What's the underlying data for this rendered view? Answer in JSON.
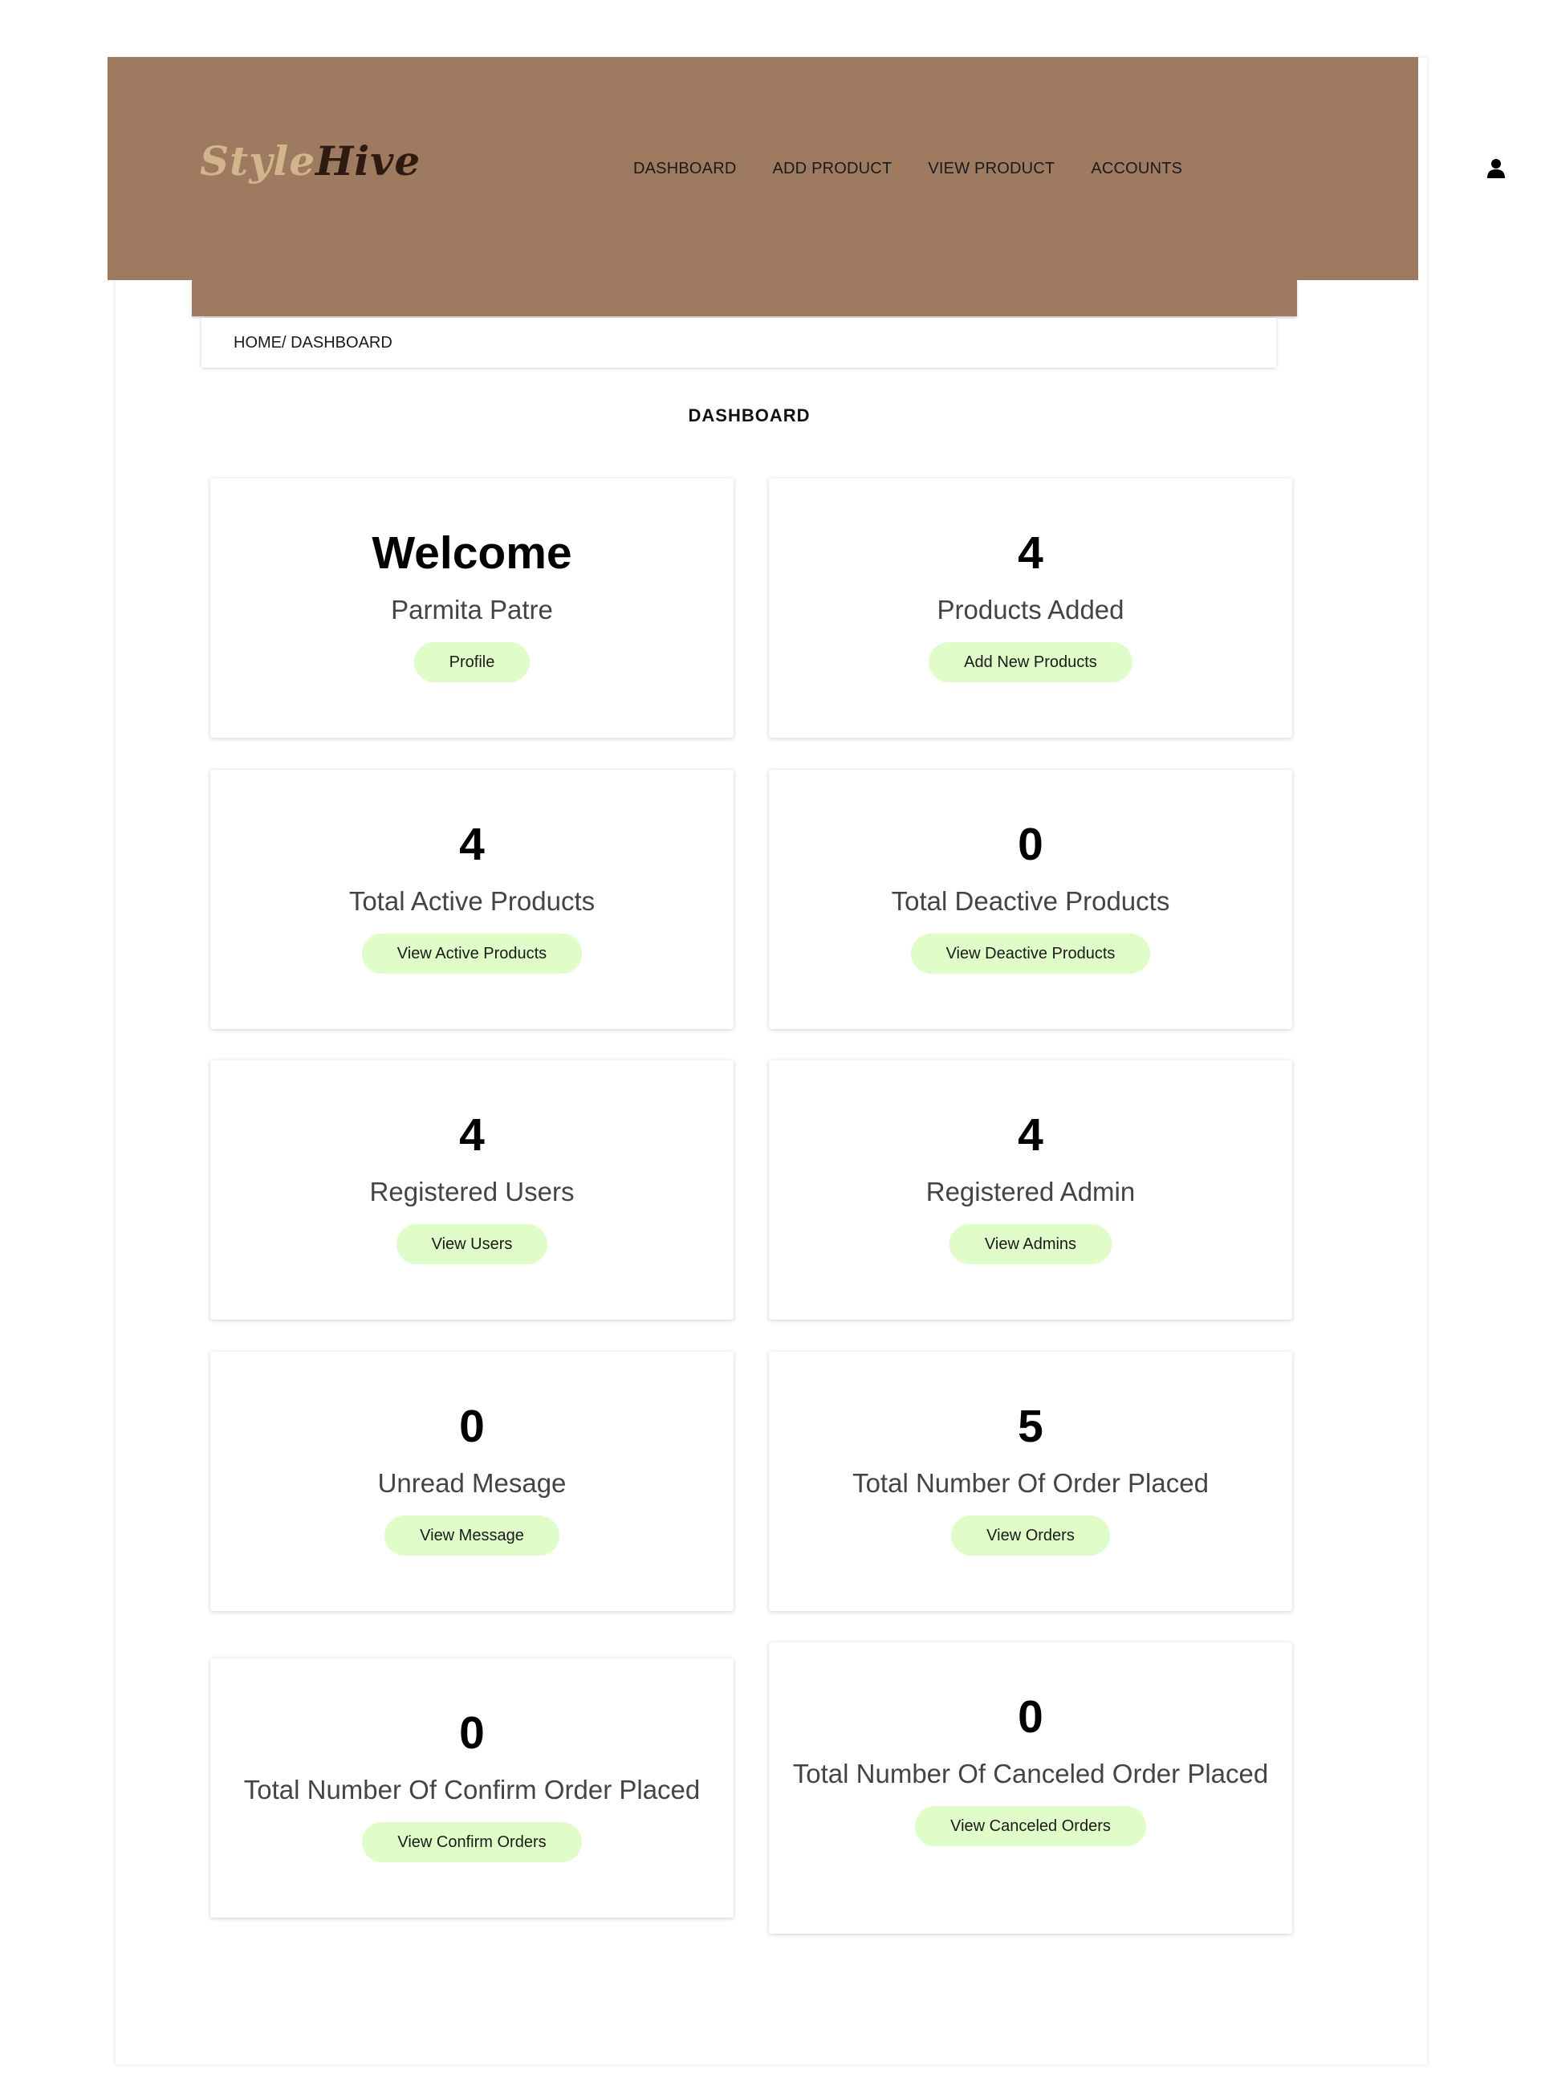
{
  "brand": {
    "part1": "Style",
    "part2": "Hive"
  },
  "nav": [
    "DASHBOARD",
    "ADD PRODUCT",
    "VIEW PRODUCT",
    "ACCOUNTS"
  ],
  "breadcrumb": "HOME/ DASHBOARD",
  "page_title": "DASHBOARD",
  "cards": [
    {
      "big": "Welcome",
      "desc": "Parmita Patre",
      "button": "Profile"
    },
    {
      "big": "4",
      "desc": "Products Added",
      "button": "Add New Products"
    },
    {
      "big": "4",
      "desc": "Total Active Products",
      "button": "View Active Products"
    },
    {
      "big": "0",
      "desc": "Total Deactive Products",
      "button": "View Deactive Products"
    },
    {
      "big": "4",
      "desc": "Registered Users",
      "button": "View Users"
    },
    {
      "big": "4",
      "desc": "Registered Admin",
      "button": "View Admins"
    },
    {
      "big": "0",
      "desc": "Unread Mesage",
      "button": "View Message"
    },
    {
      "big": "5",
      "desc": "Total Number Of Order Placed",
      "button": "View Orders"
    },
    {
      "big": "0",
      "desc": "Total Number Of Confirm Order Placed",
      "button": "View Confirm Orders"
    },
    {
      "big": "0",
      "desc": "Total Number Of Canceled Order Placed",
      "button": "View Canceled Orders"
    }
  ],
  "colors": {
    "header": "#9e7b60",
    "logo_light": "#d4b48c",
    "logo_dark": "#2e1a10",
    "button_bg": "#e0fcc8"
  },
  "icons": {
    "user": "user-icon"
  }
}
